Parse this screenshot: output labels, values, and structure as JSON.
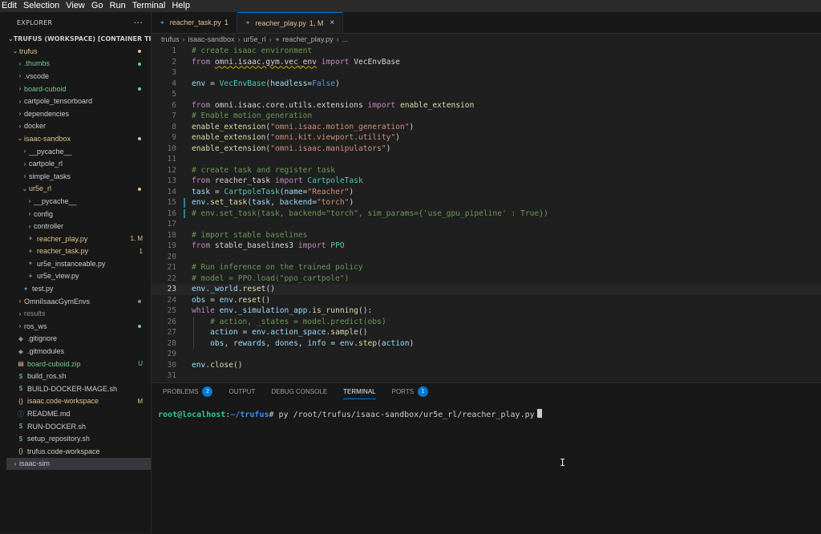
{
  "menu": [
    "Edit",
    "Selection",
    "View",
    "Go",
    "Run",
    "Terminal",
    "Help"
  ],
  "explorer": {
    "title": "EXPLORER",
    "more": "···",
    "workspace": "TRUFUS (WORKSPACE) [CONTAINER TRUF..."
  },
  "tree": [
    {
      "label": "trufus",
      "depth": 1,
      "kind": "folder-open",
      "color": "yellow",
      "dot": "yellow"
    },
    {
      "label": ".thumbs",
      "depth": 2,
      "kind": "folder",
      "color": "green",
      "dot": "green"
    },
    {
      "label": ".vscode",
      "depth": 2,
      "kind": "folder",
      "color": "plain"
    },
    {
      "label": "board-cuboid",
      "depth": 2,
      "kind": "folder",
      "color": "green",
      "dot": "green"
    },
    {
      "label": "cartpole_tensorboard",
      "depth": 2,
      "kind": "folder",
      "color": "plain"
    },
    {
      "label": "dependencies",
      "depth": 2,
      "kind": "folder",
      "color": "plain"
    },
    {
      "label": "docker",
      "depth": 2,
      "kind": "folder",
      "color": "plain"
    },
    {
      "label": "isaac-sandbox",
      "depth": 2,
      "kind": "folder-open",
      "color": "yellow",
      "dot": "yellow"
    },
    {
      "label": "__pycache__",
      "depth": 3,
      "kind": "folder",
      "color": "plain"
    },
    {
      "label": "cartpole_rl",
      "depth": 3,
      "kind": "folder",
      "color": "plain"
    },
    {
      "label": "simple_tasks",
      "depth": 3,
      "kind": "folder",
      "color": "plain"
    },
    {
      "label": "ur5e_rl",
      "depth": 3,
      "kind": "folder-open",
      "color": "yellow",
      "dot": "yellow"
    },
    {
      "label": "__pycache__",
      "depth": 4,
      "kind": "folder",
      "color": "plain"
    },
    {
      "label": "config",
      "depth": 4,
      "kind": "folder",
      "color": "plain"
    },
    {
      "label": "controller",
      "depth": 4,
      "kind": "folder",
      "color": "plain"
    },
    {
      "label": "reacher_play.py",
      "depth": 4,
      "kind": "py",
      "color": "yellow",
      "badge": "1, M"
    },
    {
      "label": "reacher_task.py",
      "depth": 4,
      "kind": "py",
      "color": "yellow",
      "badge": "1"
    },
    {
      "label": "ur5e_instanceable.py",
      "depth": 4,
      "kind": "py",
      "color": "plain"
    },
    {
      "label": "ur5e_view.py",
      "depth": 4,
      "kind": "py",
      "color": "plain"
    },
    {
      "label": "test.py",
      "depth": 3,
      "kind": "py",
      "color": "plain"
    },
    {
      "label": "OmniIsaacGymEnvs",
      "depth": 2,
      "kind": "folder",
      "color": "plain",
      "dot": "gray"
    },
    {
      "label": "results",
      "depth": 2,
      "kind": "folder",
      "color": "gray"
    },
    {
      "label": "ros_ws",
      "depth": 2,
      "kind": "folder",
      "color": "plain",
      "dot": "green"
    },
    {
      "label": ".gitignore",
      "depth": 2,
      "kind": "git",
      "color": "plain"
    },
    {
      "label": ".gitmodules",
      "depth": 2,
      "kind": "git",
      "color": "plain"
    },
    {
      "label": "board-cuboid.zip",
      "depth": 2,
      "kind": "zip",
      "color": "green",
      "badge": "U"
    },
    {
      "label": "build_ros.sh",
      "depth": 2,
      "kind": "sh",
      "color": "plain"
    },
    {
      "label": "BUILD-DOCKER-IMAGE.sh",
      "depth": 2,
      "kind": "sh",
      "color": "plain"
    },
    {
      "label": "isaac.code-workspace",
      "depth": 2,
      "kind": "json",
      "color": "yellow",
      "badge": "M"
    },
    {
      "label": "README.md",
      "depth": 2,
      "kind": "info",
      "color": "plain"
    },
    {
      "label": "RUN-DOCKER.sh",
      "depth": 2,
      "kind": "sh",
      "color": "plain"
    },
    {
      "label": "setup_repository.sh",
      "depth": 2,
      "kind": "sh",
      "color": "plain"
    },
    {
      "label": "trufus.code-workspace",
      "depth": 2,
      "kind": "json",
      "color": "plain"
    },
    {
      "label": "isaac-sim",
      "depth": 1,
      "kind": "folder",
      "color": "plain",
      "selected": true
    }
  ],
  "tabs": [
    {
      "label": "reacher_task.py",
      "status": "1",
      "active": false
    },
    {
      "label": "reacher_play.py",
      "status": "1, M",
      "active": true,
      "close": "×"
    }
  ],
  "breadcrumb": [
    "trufus",
    "isaac-sandbox",
    "ur5e_rl",
    "reacher_play.py",
    "..."
  ],
  "code": {
    "current_line": 23,
    "lines": [
      {
        "n": "1",
        "t": [
          [
            "cm",
            "# create isaac environment"
          ]
        ]
      },
      {
        "n": "2",
        "t": [
          [
            "kw",
            "from "
          ],
          [
            "sq",
            "omni.isaac.gym.vec_env"
          ],
          [
            "kw",
            " import "
          ],
          [
            "pl",
            "VecEnvBase"
          ]
        ]
      },
      {
        "n": "3",
        "t": []
      },
      {
        "n": "4",
        "t": [
          [
            "var",
            "env"
          ],
          [
            "pl",
            " = "
          ],
          [
            "cls",
            "VecEnvBase"
          ],
          [
            "pl",
            "("
          ],
          [
            "var",
            "headless"
          ],
          [
            "pl",
            "="
          ],
          [
            "bool",
            "False"
          ],
          [
            "pl",
            ")"
          ]
        ]
      },
      {
        "n": "5",
        "t": []
      },
      {
        "n": "6",
        "t": [
          [
            "kw",
            "from "
          ],
          [
            "pl",
            "omni.isaac.core.utils.extensions "
          ],
          [
            "kw",
            "import "
          ],
          [
            "fn",
            "enable_extension"
          ]
        ]
      },
      {
        "n": "7",
        "t": [
          [
            "cm",
            "# Enable motion_generation"
          ]
        ]
      },
      {
        "n": "8",
        "t": [
          [
            "fn",
            "enable_extension"
          ],
          [
            "pl",
            "("
          ],
          [
            "str",
            "\"omni.isaac.motion_generation\""
          ],
          [
            "pl",
            ")"
          ]
        ]
      },
      {
        "n": "9",
        "t": [
          [
            "fn",
            "enable_extension"
          ],
          [
            "pl",
            "("
          ],
          [
            "str",
            "\"omni.kit.viewport.utility\""
          ],
          [
            "pl",
            ")"
          ]
        ]
      },
      {
        "n": "10",
        "t": [
          [
            "fn",
            "enable_extension"
          ],
          [
            "pl",
            "("
          ],
          [
            "str",
            "\"omni.isaac.manipulators\""
          ],
          [
            "pl",
            ")"
          ]
        ]
      },
      {
        "n": "11",
        "t": []
      },
      {
        "n": "12",
        "t": [
          [
            "cm",
            "# create task and register task"
          ]
        ]
      },
      {
        "n": "13",
        "t": [
          [
            "kw",
            "from "
          ],
          [
            "pl",
            "reacher_task "
          ],
          [
            "kw",
            "import "
          ],
          [
            "cls",
            "CartpoleTask"
          ]
        ]
      },
      {
        "n": "14",
        "t": [
          [
            "var",
            "task"
          ],
          [
            "pl",
            " = "
          ],
          [
            "cls",
            "CartpoleTask"
          ],
          [
            "pl",
            "("
          ],
          [
            "var",
            "name"
          ],
          [
            "pl",
            "="
          ],
          [
            "str",
            "\"Reacher\""
          ],
          [
            "pl",
            ")"
          ]
        ]
      },
      {
        "n": "15",
        "t": [
          [
            "var",
            "env"
          ],
          [
            "pl",
            "."
          ],
          [
            "fn",
            "set_task"
          ],
          [
            "pl",
            "("
          ],
          [
            "var",
            "task"
          ],
          [
            "pl",
            ", "
          ],
          [
            "var",
            "backend"
          ],
          [
            "pl",
            "="
          ],
          [
            "str",
            "\"torch\""
          ],
          [
            "pl",
            ")"
          ]
        ],
        "mark": true
      },
      {
        "n": "16",
        "t": [
          [
            "cm",
            "# env.set_task(task, backend=\"torch\", sim_params={'use_gpu_pipeline' : True})"
          ]
        ],
        "mark": true
      },
      {
        "n": "17",
        "t": []
      },
      {
        "n": "18",
        "t": [
          [
            "cm",
            "# import stable baselines"
          ]
        ]
      },
      {
        "n": "19",
        "t": [
          [
            "kw",
            "from "
          ],
          [
            "pl",
            "stable_baselines3 "
          ],
          [
            "kw",
            "import "
          ],
          [
            "cls",
            "PPO"
          ]
        ]
      },
      {
        "n": "20",
        "t": []
      },
      {
        "n": "21",
        "t": [
          [
            "cm",
            "# Run inference on the trained policy"
          ]
        ]
      },
      {
        "n": "22",
        "t": [
          [
            "cm",
            "# model = PPO.load(\"ppo_cartpole\")"
          ]
        ]
      },
      {
        "n": "23",
        "t": [
          [
            "var",
            "env"
          ],
          [
            "pl",
            "."
          ],
          [
            "var",
            "_world"
          ],
          [
            "pl",
            "."
          ],
          [
            "fn",
            "reset"
          ],
          [
            "pl",
            "()"
          ]
        ]
      },
      {
        "n": "24",
        "t": [
          [
            "var",
            "obs"
          ],
          [
            "pl",
            " = "
          ],
          [
            "var",
            "env"
          ],
          [
            "pl",
            "."
          ],
          [
            "fn",
            "reset"
          ],
          [
            "pl",
            "()"
          ]
        ]
      },
      {
        "n": "25",
        "t": [
          [
            "kw",
            "while "
          ],
          [
            "var",
            "env"
          ],
          [
            "pl",
            "."
          ],
          [
            "var",
            "_simulation_app"
          ],
          [
            "pl",
            "."
          ],
          [
            "fn",
            "is_running"
          ],
          [
            "pl",
            "():"
          ]
        ]
      },
      {
        "n": "26",
        "t": [
          [
            "pl",
            "    "
          ],
          [
            "cm",
            "# action, _states = model.predict(obs)"
          ]
        ],
        "indent": true
      },
      {
        "n": "27",
        "t": [
          [
            "pl",
            "    "
          ],
          [
            "var",
            "action"
          ],
          [
            "pl",
            " = "
          ],
          [
            "var",
            "env"
          ],
          [
            "pl",
            "."
          ],
          [
            "var",
            "action_space"
          ],
          [
            "pl",
            "."
          ],
          [
            "fn",
            "sample"
          ],
          [
            "pl",
            "()"
          ]
        ],
        "indent": true
      },
      {
        "n": "28",
        "t": [
          [
            "pl",
            "    "
          ],
          [
            "var",
            "obs"
          ],
          [
            "pl",
            ", "
          ],
          [
            "var",
            "rewards"
          ],
          [
            "pl",
            ", "
          ],
          [
            "var",
            "dones"
          ],
          [
            "pl",
            ", "
          ],
          [
            "var",
            "info"
          ],
          [
            "pl",
            " = "
          ],
          [
            "var",
            "env"
          ],
          [
            "pl",
            "."
          ],
          [
            "fn",
            "step"
          ],
          [
            "pl",
            "("
          ],
          [
            "var",
            "action"
          ],
          [
            "pl",
            ")"
          ]
        ],
        "indent": true
      },
      {
        "n": "29",
        "t": []
      },
      {
        "n": "30",
        "t": [
          [
            "var",
            "env"
          ],
          [
            "pl",
            "."
          ],
          [
            "fn",
            "close"
          ],
          [
            "pl",
            "()"
          ]
        ]
      },
      {
        "n": "31",
        "t": []
      }
    ]
  },
  "panel": {
    "tabs": [
      {
        "label": "PROBLEMS",
        "badge": "2"
      },
      {
        "label": "OUTPUT"
      },
      {
        "label": "DEBUG CONSOLE"
      },
      {
        "label": "TERMINAL",
        "active": true
      },
      {
        "label": "PORTS",
        "badge": "1"
      }
    ]
  },
  "terminal": {
    "user": "root@localhost",
    "sep": ":",
    "path": "~/trufus",
    "prompt": "#",
    "command": " py /root/trufus/isaac-sandbox/ur5e_rl/reacher_play.py"
  },
  "colors": {
    "accent": "#0078d4",
    "git_modified": "#e2c08d",
    "git_untracked": "#73c991"
  }
}
